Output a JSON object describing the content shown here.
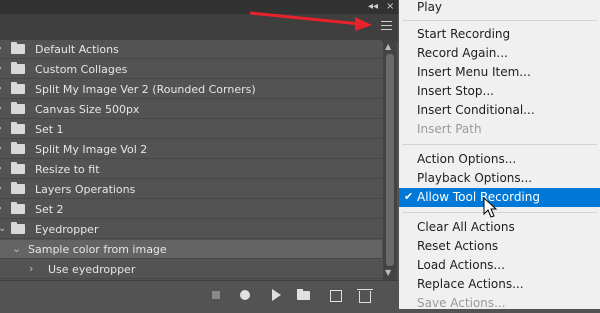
{
  "panel": {
    "collapse_glyph": "◂◂",
    "close_glyph": "×",
    "rows": [
      "Default Actions",
      "Custom Collages",
      "Split My Image Ver 2 (Rounded Corners)",
      "Canvas Size 500px",
      "Set 1",
      "Split My Image Vol 2",
      "Resize to fit",
      "Layers Operations",
      "Set 2",
      "Eyedropper"
    ],
    "child_row": "Sample color from image",
    "grandchild_row": "Use eyedropper",
    "icons": [
      "stop-icon",
      "record-icon",
      "play-icon",
      "new-set-icon",
      "new-action-icon",
      "delete-icon"
    ]
  },
  "menu": {
    "items": [
      {
        "label": "Play",
        "disabled": false
      },
      {
        "label": "Start Recording",
        "disabled": false
      },
      {
        "label": "Record Again...",
        "disabled": false
      },
      {
        "label": "Insert Menu Item...",
        "disabled": false
      },
      {
        "label": "Insert Stop...",
        "disabled": false
      },
      {
        "label": "Insert Conditional...",
        "disabled": false
      },
      {
        "label": "Insert Path",
        "disabled": true
      },
      {
        "label": "Action Options...",
        "disabled": false
      },
      {
        "label": "Playback Options...",
        "disabled": false
      },
      {
        "label": "Allow Tool Recording",
        "disabled": false,
        "highlighted": true,
        "checked": true
      },
      {
        "label": "Clear All Actions",
        "disabled": false
      },
      {
        "label": "Reset Actions",
        "disabled": false
      },
      {
        "label": "Load Actions...",
        "disabled": false
      },
      {
        "label": "Replace Actions...",
        "disabled": false
      },
      {
        "label": "Save Actions...",
        "disabled": true
      }
    ],
    "highlight_color": "#0078d7",
    "check_glyph": "✔"
  },
  "annotation": {
    "arrow_color": "#e8222a"
  }
}
